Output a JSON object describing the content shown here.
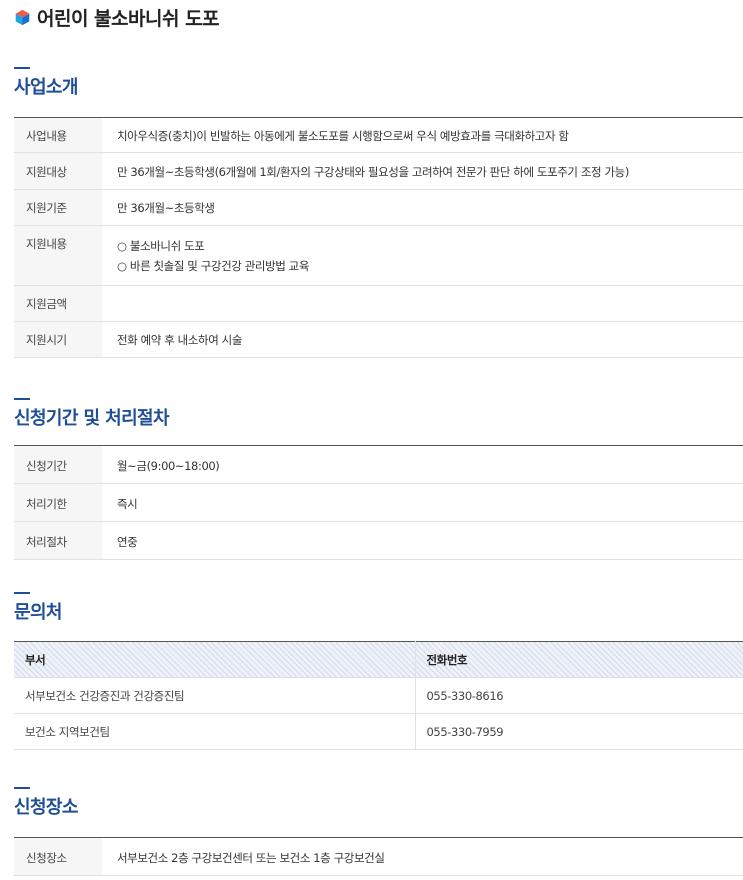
{
  "page": {
    "title": "어린이 불소바니쉬 도포",
    "icon": "cube-logo-icon",
    "accent_color": "#1f4e96"
  },
  "business_intro": {
    "heading": "사업소개",
    "rows": [
      {
        "label": "사업내용",
        "value": "치아우식증(충치)이 빈발하는 아동에게 불소도포를 시행함으로써 우식 예방효과를 극대화하고자 함"
      },
      {
        "label": "지원대상",
        "value": "만 36개월~초등학생(6개월에 1회/환자의 구강상태와 필요성을 고려하여 전문가 판단 하에 도포주기 조정 가능)"
      },
      {
        "label": "지원기준",
        "value": "만 36개월~초등학생"
      },
      {
        "label": "지원내용",
        "value_line1": "○ 불소바니쉬 도포",
        "value_line2": "○ 바른 칫솔질 및 구강건강 관리방법 교육"
      },
      {
        "label": "지원금액",
        "value": ""
      },
      {
        "label": "지원시기",
        "value": "전화 예약 후 내소하여 시술"
      }
    ]
  },
  "application_period": {
    "heading": "신청기간 및 처리절차",
    "rows": [
      {
        "label": "신청기간",
        "value": "월~금(9:00~18:00)"
      },
      {
        "label": "처리기한",
        "value": "즉시"
      },
      {
        "label": "처리절차",
        "value": "연중"
      }
    ]
  },
  "contact": {
    "heading": "문의처",
    "columns": [
      "부서",
      "전화번호"
    ],
    "rows": [
      {
        "dept": "서부보건소 건강증진과 건강증진팀",
        "phone": "055-330-8616"
      },
      {
        "dept": "보건소 지역보건팀",
        "phone": "055-330-7959"
      }
    ]
  },
  "application_place": {
    "heading": "신청장소",
    "rows": [
      {
        "label": "신청장소",
        "value": "서부보건소 2층 구강보건센터 또는 보건소 1층 구강보건실"
      }
    ]
  }
}
